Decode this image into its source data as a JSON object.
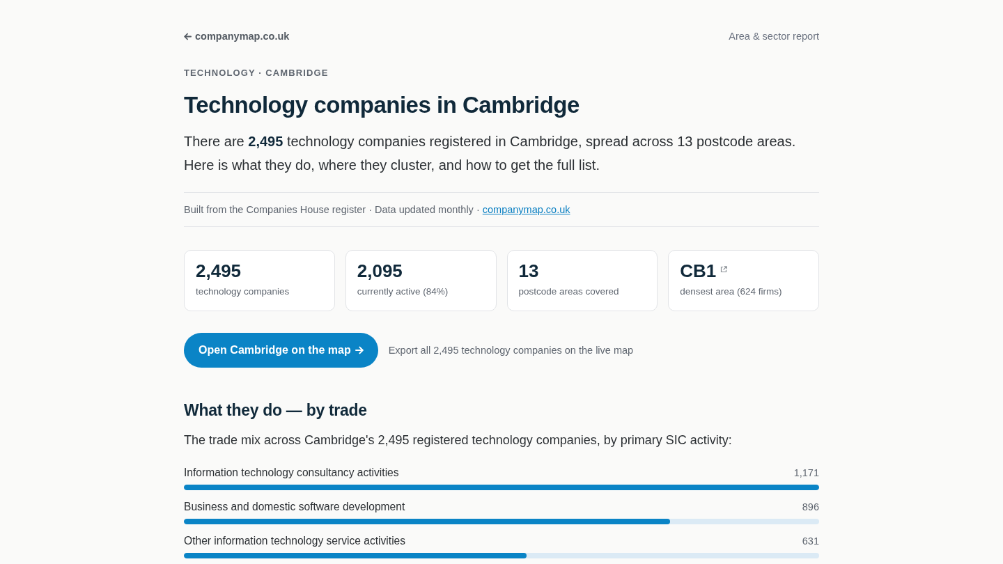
{
  "top_nav": {
    "back_link": "companymap.co.uk",
    "report_label": "Area & sector report"
  },
  "eyebrow": "TECHNOLOGY · CAMBRIDGE",
  "title": "Technology companies in Cambridge",
  "intro": "There are **2,495** technology companies registered in Cambridge, spread across 13 postcode areas. Here is what they do, where they cluster, and how to get the full list.",
  "source_line": {
    "text": "Built from the Companies House register · Data updated monthly ·",
    "link": "companymap.co.uk"
  },
  "stats": [
    {
      "value": "2,495",
      "label": "technology companies",
      "external_link": false
    },
    {
      "value": "2,095",
      "label": "currently active (84%)",
      "external_link": false
    },
    {
      "value": "13",
      "label": "postcode areas covered",
      "external_link": false
    },
    {
      "value": "CB1",
      "label": "densest area (624 firms)",
      "external_link": true
    }
  ],
  "cta": {
    "button": "Open Cambridge on the map",
    "note": "Export all 2,495 technology companies on the live map"
  },
  "trade_section": {
    "heading": "What they do — by trade",
    "intro": "The trade mix across Cambridge's 2,495 registered technology companies, by primary SIC activity:",
    "rows": [
      {
        "label": "Information technology consultancy activities",
        "count": "1,171",
        "level": 1.0
      },
      {
        "label": "Business and domestic software development",
        "count": "896",
        "level": 0.765
      },
      {
        "label": "Other information technology service activities",
        "count": "631",
        "level": 0.539
      }
    ]
  }
}
